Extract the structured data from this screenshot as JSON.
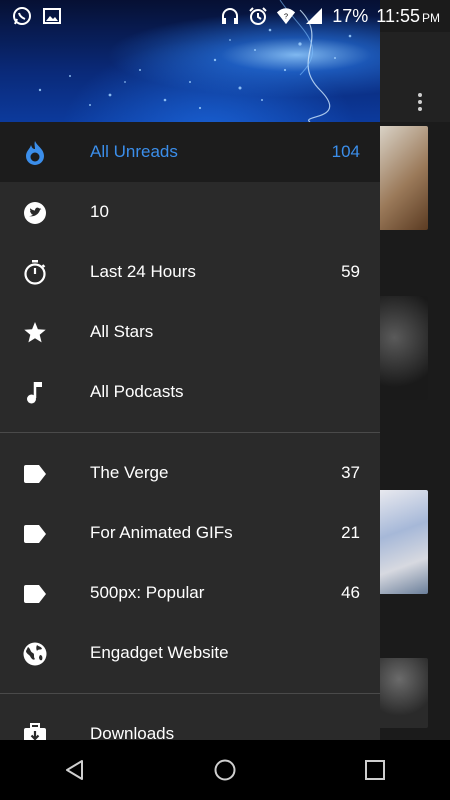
{
  "status_bar": {
    "battery_percent": "17%",
    "time": "11:55",
    "ampm": "PM"
  },
  "drawer": {
    "items": [
      {
        "label": "All Unreads",
        "count": "104",
        "icon": "flame-icon"
      },
      {
        "label": "10",
        "count": "",
        "icon": "twitter-icon"
      },
      {
        "label": "Last 24 Hours",
        "count": "59",
        "icon": "stopwatch-icon"
      },
      {
        "label": "All Stars",
        "count": "",
        "icon": "star-icon"
      },
      {
        "label": "All Podcasts",
        "count": "",
        "icon": "music-note-icon"
      }
    ],
    "feeds": [
      {
        "label": "The Verge",
        "count": "37",
        "icon": "tag-icon"
      },
      {
        "label": "For Animated GIFs",
        "count": "21",
        "icon": "tag-icon"
      },
      {
        "label": "500px: Popular",
        "count": "46",
        "icon": "tag-icon"
      },
      {
        "label": "Engadget Website",
        "count": "",
        "icon": "globe-icon"
      }
    ],
    "extras": [
      {
        "label": "Downloads",
        "icon": "download-icon"
      }
    ]
  },
  "colors": {
    "accent": "#3b8eea",
    "drawer_bg": "#2a2a2a",
    "selected_bg": "#1c1c1c"
  }
}
